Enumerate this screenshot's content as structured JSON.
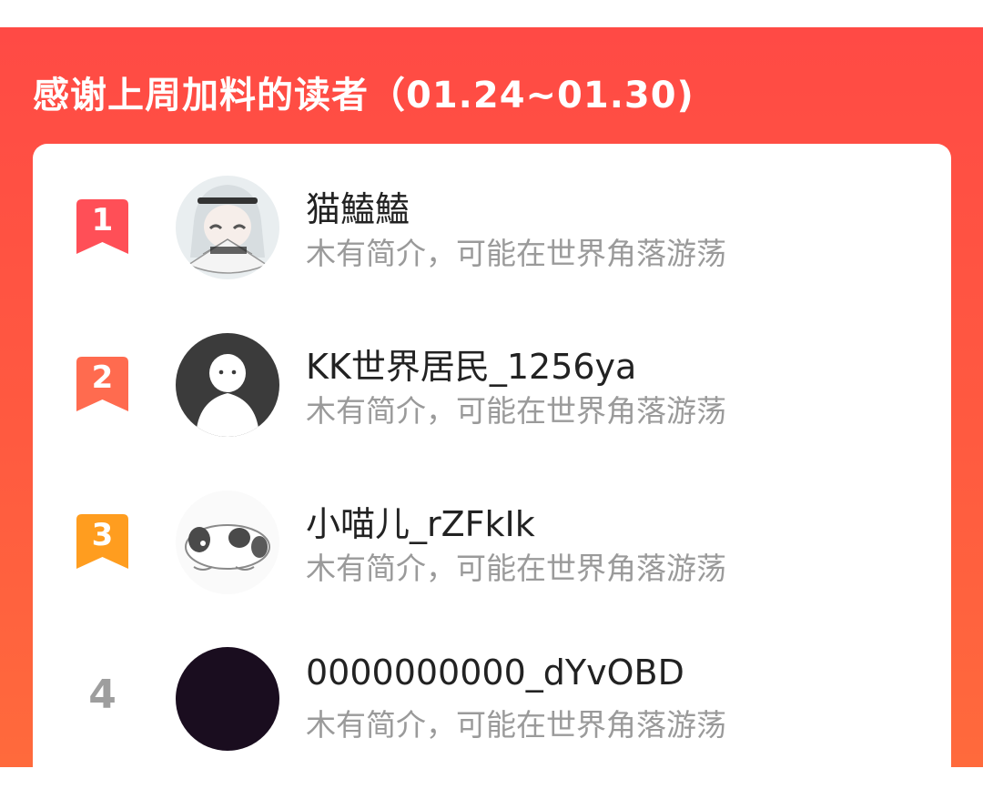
{
  "panel": {
    "title": "感谢上周加料的读者（01.24~01.30)"
  },
  "colors": {
    "panel_gradient_top": "#ff4a45",
    "panel_gradient_bottom": "#ff6a3c",
    "rank1": "#ff4f57",
    "rank2": "#ff6b4f",
    "rank3": "#ff9d1f",
    "rank_plain": "#9e9e9e",
    "name_text": "#222222",
    "bio_text": "#9a9a9a"
  },
  "readers": [
    {
      "rank": "1",
      "badge_icon": "ribbon-badge-icon",
      "avatar_icon": "anime-girl-with-fan-avatar",
      "name": "猫鰪鰪",
      "bio": "木有简介，可能在世界角落游荡"
    },
    {
      "rank": "2",
      "badge_icon": "ribbon-badge-icon",
      "avatar_icon": "default-person-avatar",
      "name": "KK世界居民_1256ya",
      "bio": "木有简介，可能在世界角落游荡"
    },
    {
      "rank": "3",
      "badge_icon": "ribbon-badge-icon",
      "avatar_icon": "panda-sketch-avatar",
      "name": "小喵儿_rZFkIk",
      "bio": "木有简介，可能在世界角落游荡"
    },
    {
      "rank": "4",
      "avatar_icon": "dark-circle-avatar",
      "name": "0000000000_dYvOBD",
      "bio": "木有简介，可能在世界角落游荡"
    }
  ]
}
